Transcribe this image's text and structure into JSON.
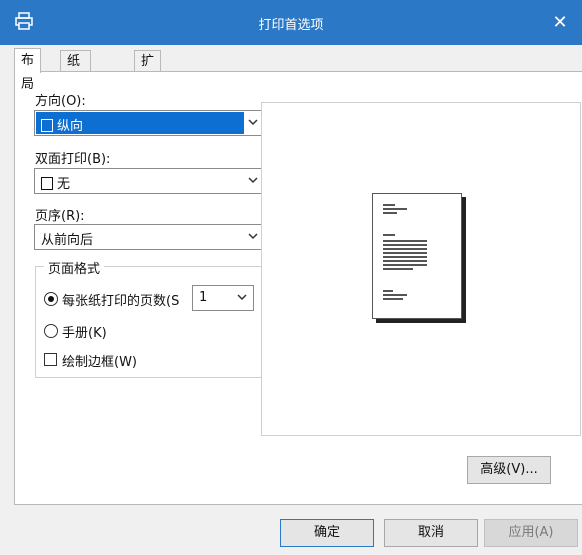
{
  "window": {
    "title": "打印首选项",
    "close_glyph": "✕"
  },
  "tabs": [
    {
      "label": "布局"
    },
    {
      "label": "纸张/质量"
    },
    {
      "label": "扩展功能"
    }
  ],
  "layout": {
    "orientation": {
      "label": "方向(O):",
      "value": "纵向"
    },
    "duplex": {
      "label": "双面打印(B):",
      "value": "无"
    },
    "page_order": {
      "label": "页序(R):",
      "value": "从前向后"
    },
    "page_format": {
      "title": "页面格式",
      "pages_per_sheet": {
        "label": "每张纸打印的页数(S",
        "value": "1",
        "selected": true
      },
      "booklet": {
        "label": "手册(K)",
        "selected": false
      },
      "draw_borders": {
        "label": "绘制边框(W)",
        "checked": false
      }
    }
  },
  "buttons": {
    "advanced": "高级(V)...",
    "ok": "确定",
    "cancel": "取消",
    "apply": "应用(A)"
  },
  "colors": {
    "titlebar": "#2b78c6",
    "selection": "#0d6fd1"
  },
  "icons": [
    "printer-icon",
    "close-icon",
    "portrait-icon",
    "document-icon",
    "chevron-down-icon"
  ]
}
